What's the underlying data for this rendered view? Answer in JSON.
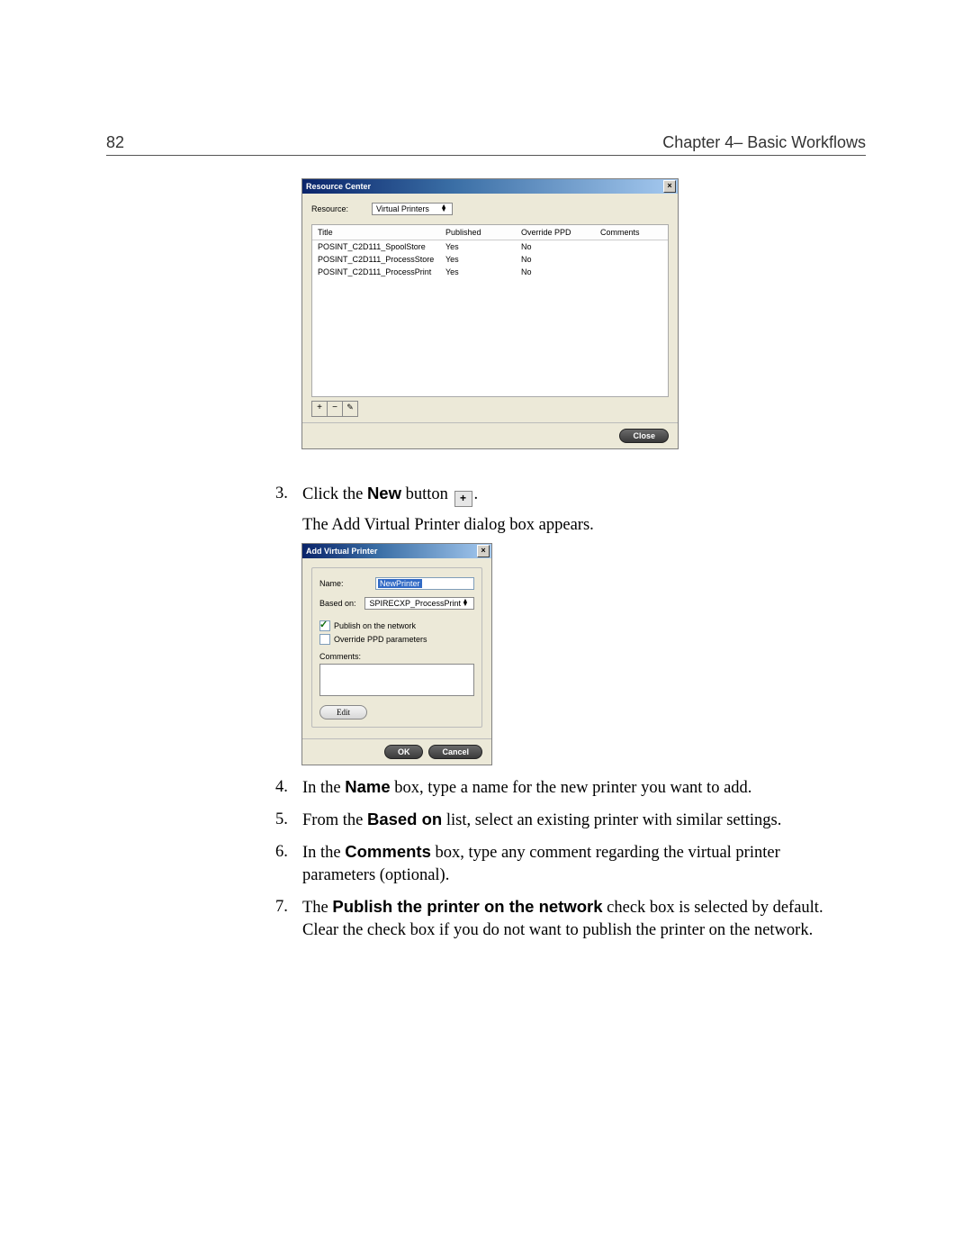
{
  "page": {
    "number": "82",
    "chapter_line": "Chapter 4– Basic Workflows"
  },
  "rc": {
    "title": "Resource Center",
    "close_glyph": "×",
    "resource_label": "Resource:",
    "resource_value": "Virtual Printers",
    "columns": {
      "title": "Title",
      "published": "Published",
      "override": "Override PPD",
      "comments": "Comments"
    },
    "rows": [
      {
        "title": "POSINT_C2D111_SpoolStore",
        "published": "Yes",
        "override": "No",
        "comments": ""
      },
      {
        "title": "POSINT_C2D111_ProcessStore",
        "published": "Yes",
        "override": "No",
        "comments": ""
      },
      {
        "title": "POSINT_C2D111_ProcessPrint",
        "published": "Yes",
        "override": "No",
        "comments": ""
      }
    ],
    "tool_plus": "+",
    "tool_minus": "−",
    "tool_edit_glyph": "✎",
    "close_btn": "Close"
  },
  "text": {
    "step3_num": "3.",
    "step3_a": "Click the ",
    "step3_bold": "New",
    "step3_b": " button ",
    "step3_icon_glyph": "+",
    "step3_c": ".",
    "step3_follow": "The Add Virtual Printer dialog box appears.",
    "step4_num": "4.",
    "step4_a": "In the ",
    "step4_bold": "Name",
    "step4_b": " box, type a name for the new printer you want to add.",
    "step5_num": "5.",
    "step5_a": "From the ",
    "step5_bold": "Based on",
    "step5_b": " list, select an existing printer with similar settings.",
    "step6_num": "6.",
    "step6_a": "In the ",
    "step6_bold": "Comments",
    "step6_b": " box, type any comment regarding the virtual printer parameters (optional).",
    "step7_num": "7.",
    "step7_a": "The ",
    "step7_bold": "Publish the printer on the network",
    "step7_b": " check box is selected by default. Clear the check box if you do not want to publish the printer on the network."
  },
  "avp": {
    "title": "Add Virtual Printer",
    "close_glyph": "×",
    "name_label": "Name:",
    "name_value": "NewPrinter",
    "based_label": "Based on:",
    "based_value": "SPIRECXP_ProcessPrint",
    "check_publish": "Publish on the network",
    "check_override": "Override PPD parameters",
    "comments_label": "Comments:",
    "edit_btn": "Edit",
    "ok_btn": "OK",
    "cancel_btn": "Cancel"
  }
}
